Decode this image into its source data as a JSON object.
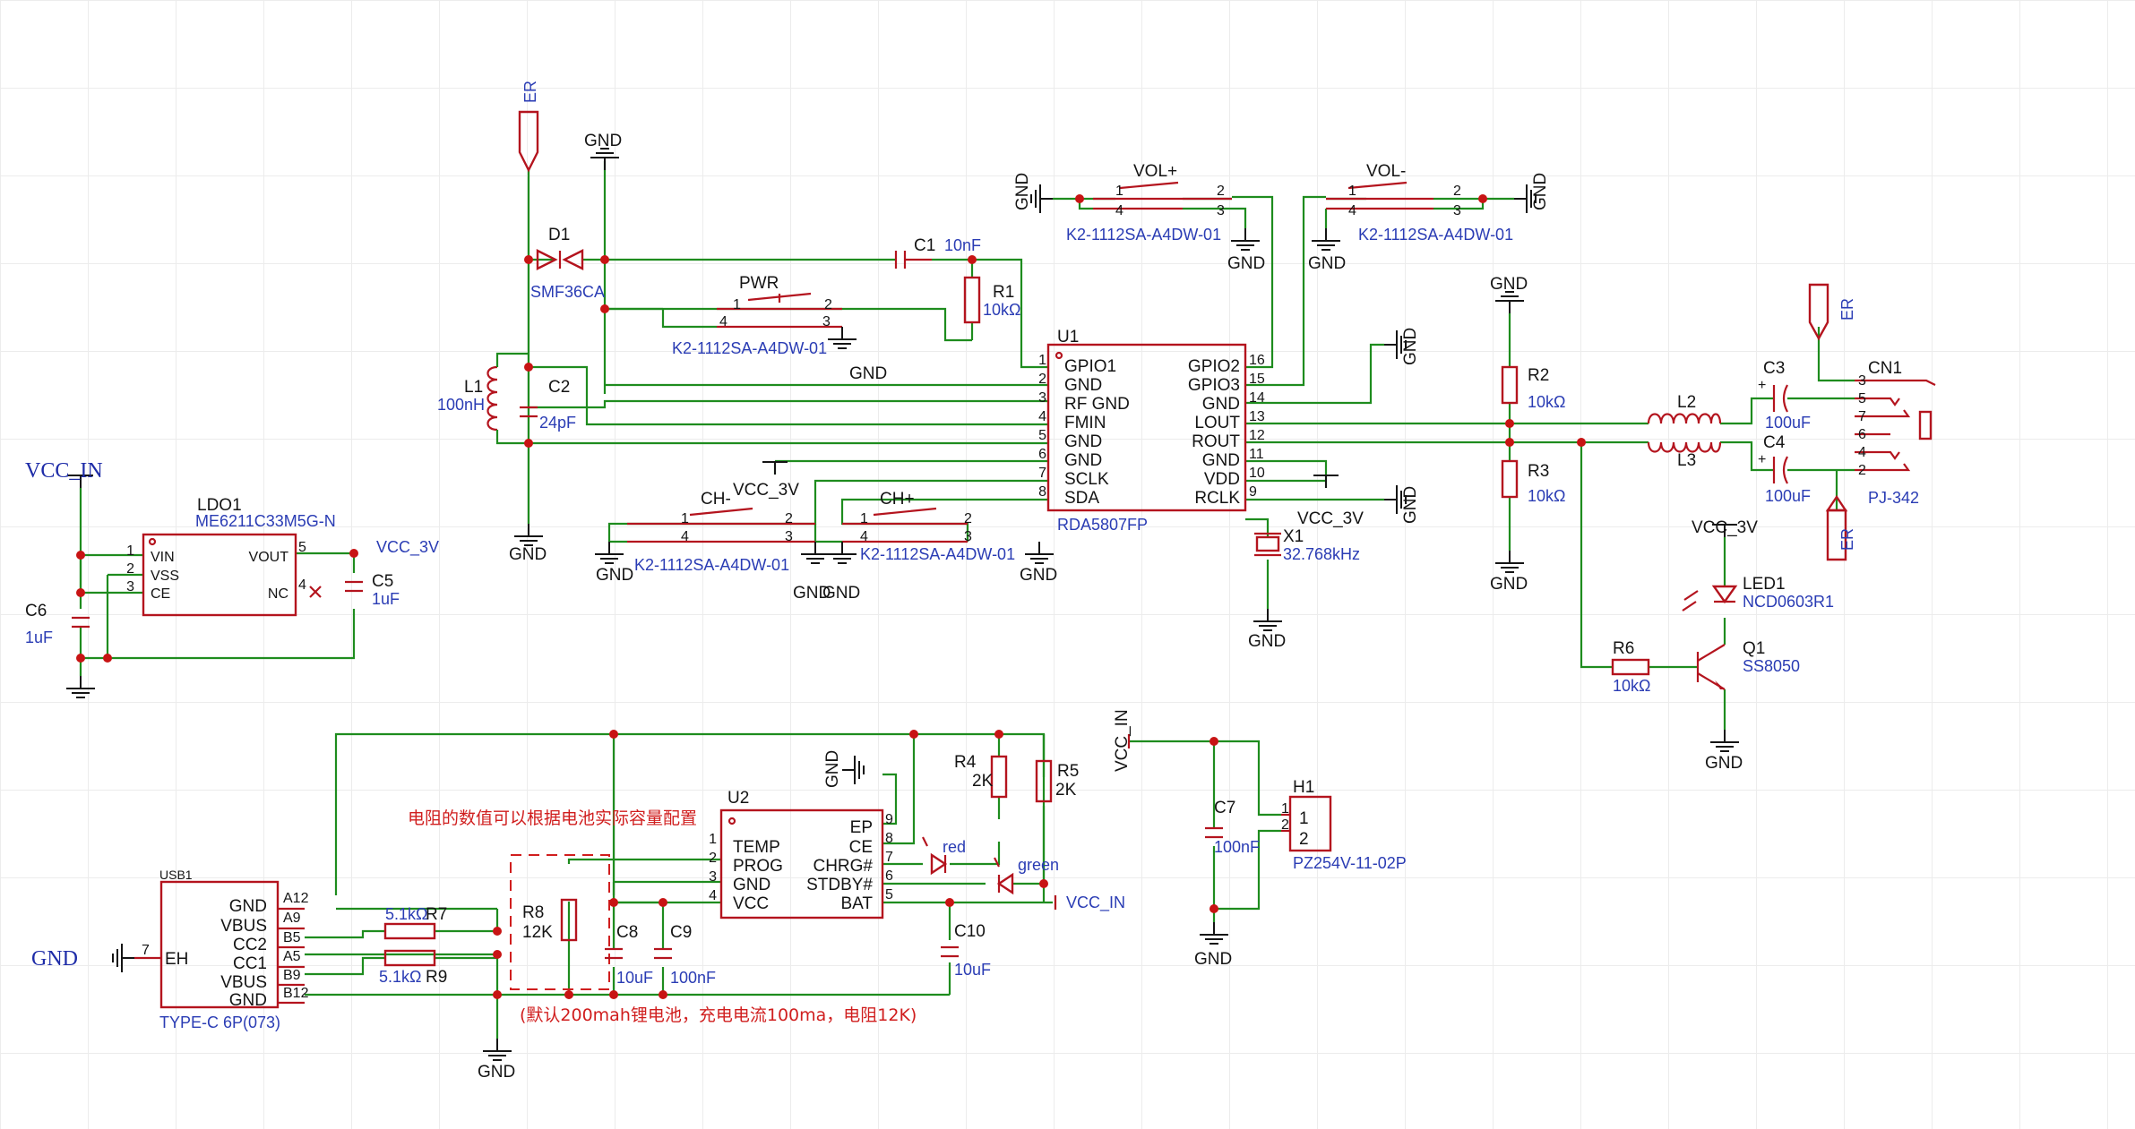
{
  "nets": {
    "gnd": "GND",
    "vcc_3v": "VCC_3V",
    "vcc_in": "VCC_IN",
    "er": "ER"
  },
  "components": {
    "u1": {
      "ref": "U1",
      "value": "RDA5807FP",
      "left_pins": [
        {
          "num": "1",
          "name": "GPIO1"
        },
        {
          "num": "2",
          "name": "GND"
        },
        {
          "num": "3",
          "name": "RF GND"
        },
        {
          "num": "4",
          "name": "FMIN"
        },
        {
          "num": "5",
          "name": "GND"
        },
        {
          "num": "6",
          "name": "GND"
        },
        {
          "num": "7",
          "name": "SCLK"
        },
        {
          "num": "8",
          "name": "SDA"
        }
      ],
      "right_pins": [
        {
          "num": "16",
          "name": "GPIO2"
        },
        {
          "num": "15",
          "name": "GPIO3"
        },
        {
          "num": "14",
          "name": "GND"
        },
        {
          "num": "13",
          "name": "LOUT"
        },
        {
          "num": "12",
          "name": "ROUT"
        },
        {
          "num": "11",
          "name": "GND"
        },
        {
          "num": "10",
          "name": "VDD"
        },
        {
          "num": "9",
          "name": "RCLK"
        }
      ]
    },
    "u2": {
      "ref": "U2",
      "left_pins": [
        {
          "num": "1",
          "name": "TEMP"
        },
        {
          "num": "2",
          "name": "PROG"
        },
        {
          "num": "3",
          "name": "GND"
        },
        {
          "num": "4",
          "name": "VCC"
        }
      ],
      "right_pins": [
        {
          "num": "9",
          "name": "EP"
        },
        {
          "num": "8",
          "name": "CE"
        },
        {
          "num": "7",
          "name": "CHRG#"
        },
        {
          "num": "6",
          "name": "STDBY#"
        },
        {
          "num": "5",
          "name": "BAT"
        }
      ]
    },
    "ldo1": {
      "ref": "LDO1",
      "value": "ME6211C33M5G-N",
      "left_pins": [
        {
          "num": "1",
          "name": "VIN"
        },
        {
          "num": "2",
          "name": "VSS"
        },
        {
          "num": "3",
          "name": "CE"
        }
      ],
      "right_pins": [
        {
          "num": "5",
          "name": "VOUT"
        },
        {
          "num": "4",
          "name": "NC"
        }
      ]
    },
    "usb1": {
      "ref": "USB1",
      "value": "TYPE-C 6P(073)",
      "left_pin": {
        "num": "7",
        "name": "EH"
      },
      "right_pins": [
        {
          "num": "A12",
          "name": "GND"
        },
        {
          "num": "A9",
          "name": "VBUS"
        },
        {
          "num": "B5",
          "name": "CC2"
        },
        {
          "num": "A5",
          "name": "CC1"
        },
        {
          "num": "B9",
          "name": "VBUS"
        },
        {
          "num": "B12",
          "name": "GND"
        }
      ]
    },
    "cn1": {
      "ref": "CN1",
      "value": "PJ-342",
      "pins": [
        "3",
        "5",
        "7",
        "6",
        "4",
        "2"
      ]
    },
    "h1": {
      "ref": "H1",
      "value": "PZ254V-11-02P",
      "pins": [
        "1",
        "2"
      ]
    },
    "d1": {
      "ref": "D1",
      "value": "SMF36CA"
    },
    "q1": {
      "ref": "Q1",
      "value": "SS8050"
    },
    "led1": {
      "ref": "LED1",
      "value": "NCD0603R1"
    },
    "x1": {
      "ref": "X1",
      "value": "32.768kHz"
    },
    "l1": {
      "ref": "L1",
      "value": "100nH"
    },
    "l2": {
      "ref": "L2"
    },
    "l3": {
      "ref": "L3"
    },
    "c1": {
      "ref": "C1",
      "value": "10nF"
    },
    "c2": {
      "ref": "C2",
      "value": "24pF"
    },
    "c3": {
      "ref": "C3",
      "value": "100uF"
    },
    "c4": {
      "ref": "C4",
      "value": "100uF"
    },
    "c5": {
      "ref": "C5",
      "value": "1uF"
    },
    "c6": {
      "ref": "C6",
      "value": "1uF"
    },
    "c7": {
      "ref": "C7",
      "value": "100nF"
    },
    "c8": {
      "ref": "C8",
      "value": "10uF"
    },
    "c9": {
      "ref": "C9",
      "value": "100nF"
    },
    "c10": {
      "ref": "C10",
      "value": "10uF"
    },
    "r1": {
      "ref": "R1",
      "value": "10kΩ"
    },
    "r2": {
      "ref": "R2",
      "value": "10kΩ"
    },
    "r3": {
      "ref": "R3",
      "value": "10kΩ"
    },
    "r4": {
      "ref": "R4",
      "value": "2K"
    },
    "r5": {
      "ref": "R5",
      "value": "2K"
    },
    "r6": {
      "ref": "R6",
      "value": "10kΩ"
    },
    "r7": {
      "ref": "R7",
      "value": "5.1kΩ"
    },
    "r8": {
      "ref": "R8",
      "value": "12K"
    },
    "r9": {
      "ref": "R9",
      "value": "5.1kΩ"
    },
    "led_red": {
      "value": "red"
    },
    "led_green": {
      "value": "green"
    }
  },
  "switches": [
    {
      "name": "PWR",
      "part": "K2-1112SA-A4DW-01",
      "pins": [
        "1",
        "2",
        "4",
        "3"
      ]
    },
    {
      "name": "VOL+",
      "part": "K2-1112SA-A4DW-01",
      "pins": [
        "1",
        "2",
        "4",
        "3"
      ]
    },
    {
      "name": "VOL-",
      "part": "K2-1112SA-A4DW-01",
      "pins": [
        "1",
        "2",
        "4",
        "3"
      ]
    },
    {
      "name": "CH-",
      "part": "K2-1112SA-A4DW-01",
      "pins": [
        "1",
        "2",
        "4",
        "3"
      ]
    },
    {
      "name": "CH+",
      "part": "K2-1112SA-A4DW-01",
      "pins": [
        "1",
        "2",
        "4",
        "3"
      ]
    }
  ],
  "notes": {
    "resistor_note": "电阻的数值可以根据电池实际容量配置",
    "battery_note": "(默认200mah锂电池，充电电流100ma，电阻12K)"
  },
  "colors": {
    "wire": "#1e8c1e",
    "symbol": "#b4141e",
    "junction": "#c81414",
    "value_text": "#2a3cb4",
    "note_text": "#d01e1e"
  }
}
